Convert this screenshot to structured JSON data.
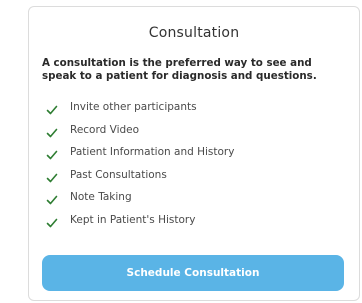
{
  "card": {
    "title": "Consultation",
    "description": "A consultation is the preferred way to see and speak to a patient for diagnosis and questions.",
    "features": [
      {
        "label": "Invite other participants",
        "icon": "check-icon"
      },
      {
        "label": "Record Video",
        "icon": "check-icon"
      },
      {
        "label": "Patient Information and History",
        "icon": "check-icon"
      },
      {
        "label": "Past Consultations",
        "icon": "check-icon"
      },
      {
        "label": "Note Taking",
        "icon": "check-icon"
      },
      {
        "label": "Kept in Patient's History",
        "icon": "check-icon"
      }
    ],
    "cta_label": "Schedule Consultation"
  },
  "colors": {
    "check": "#2e7d32",
    "button": "#5ab4e6",
    "button_text": "#ffffff",
    "border": "#dcdcdc"
  }
}
